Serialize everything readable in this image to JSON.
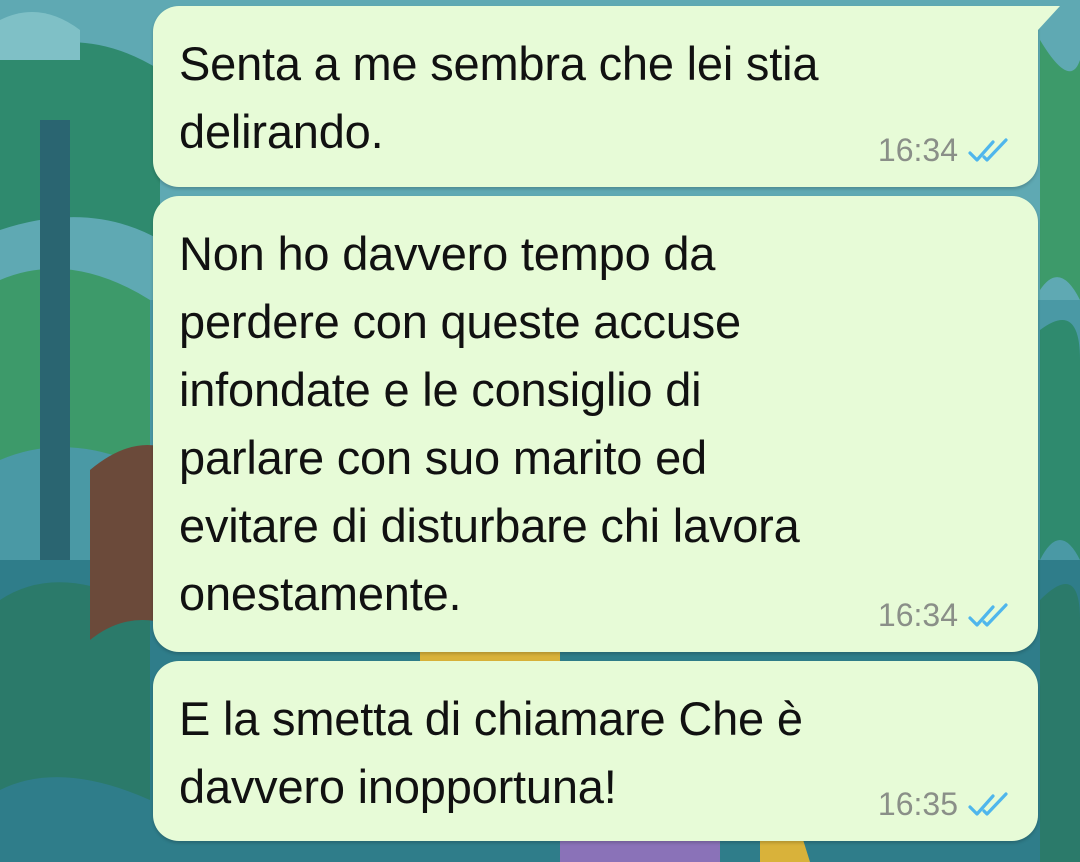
{
  "chat": {
    "messages": [
      {
        "text": "Senta a me sembra che lei stia\ndelirando.",
        "time": "16:34",
        "status": "read"
      },
      {
        "text": "Non ho davvero tempo da\nperdere con queste accuse\ninfondate e le consiglio di\nparlare con suo marito ed\nevitare di disturbare chi lavora\nonestamente.",
        "time": "16:34",
        "status": "read"
      },
      {
        "text": "E la smetta di chiamare Che è\ndavvero inopportuna!",
        "time": "16:35",
        "status": "read"
      }
    ]
  },
  "colors": {
    "bubble_outgoing": "#e7fbd7",
    "read_ticks": "#4fb6ec",
    "time_text": "#8a8f88"
  },
  "icons": {
    "read_status": "double-check-icon"
  }
}
